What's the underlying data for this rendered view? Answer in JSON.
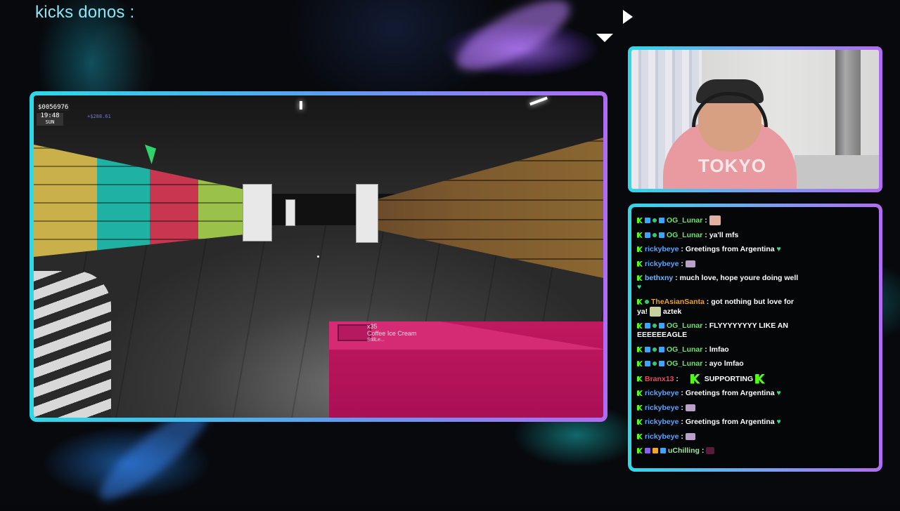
{
  "overlay": {
    "title": "kicks donos :"
  },
  "game": {
    "hud_money": "$0056976",
    "hud_time": "19:48",
    "hud_day": "SUN",
    "hud_delta": "+$288.61",
    "box_count": "x35",
    "box_name": "Coffee Ice Cream",
    "box_sub": "StillLe..."
  },
  "webcam": {
    "shirt_text": "TOKYO"
  },
  "chat": {
    "messages": [
      {
        "user": "OG_Lunar",
        "sep": " : ",
        "text": ""
      },
      {
        "user": "OG_Lunar",
        "sep": " : ",
        "text": "ya'll mfs"
      },
      {
        "user": "rickybeye",
        "sep": " : ",
        "text": "Greetings from Argentina"
      },
      {
        "user": "rickybeye",
        "sep": " : ",
        "text": ""
      },
      {
        "user": "bethxny",
        "sep": " : ",
        "text": "much love, hope youre doing well"
      },
      {
        "user": "TheAsianSanta",
        "sep": " : ",
        "text": "got nothing but love for ya!",
        "text2": "aztek"
      },
      {
        "user": "OG_Lunar",
        "sep": " : ",
        "text": "FLYYYYYYYY LIKE AN EEEEEEAGLE"
      },
      {
        "user": "OG_Lunar",
        "sep": " : ",
        "text": "lmfao"
      },
      {
        "user": "OG_Lunar",
        "sep": " : ",
        "text": "ayo lmfao"
      },
      {
        "user": "Branx13",
        "sep": " : ",
        "text": "SUPPORTING"
      },
      {
        "user": "rickybeye",
        "sep": " : ",
        "text": "Greetings from Argentina"
      },
      {
        "user": "rickybeye",
        "sep": " : ",
        "text": ""
      },
      {
        "user": "rickybeye",
        "sep": " : ",
        "text": "Greetings from Argentina"
      },
      {
        "user": "rickybeye",
        "sep": " : ",
        "text": ""
      },
      {
        "user": "uChilling",
        "sep": " : ",
        "text": ""
      }
    ]
  },
  "colors": {
    "accent_cyan": "#2fd8e8",
    "accent_purple": "#b06cf0",
    "kick_green": "#53fc18"
  }
}
